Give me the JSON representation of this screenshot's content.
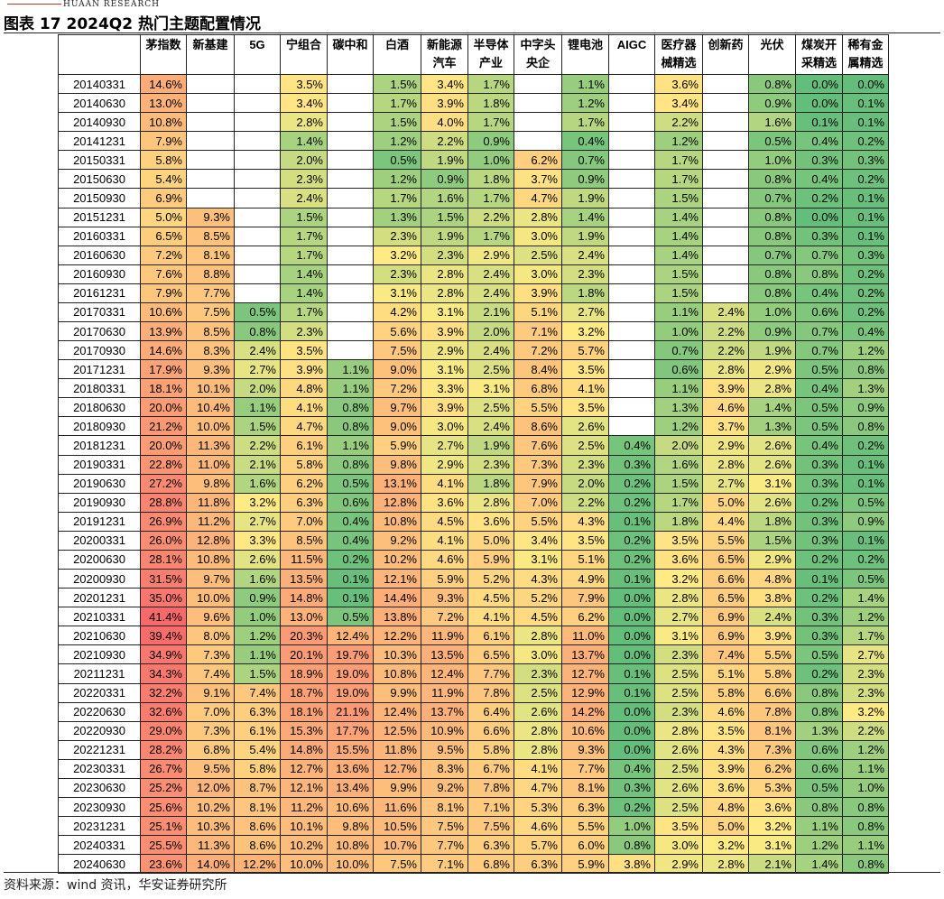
{
  "header": {
    "brand": "HUAAN RESEARCH",
    "title": "图表 17 2024Q2 热门主题配置情况"
  },
  "table": {
    "columns": [
      "",
      "茅指数",
      "新基建",
      "5G",
      "宁组合",
      "碳中和",
      "白酒",
      "新能源汽车",
      "半导体产业",
      "中字头央企",
      "锂电池",
      "AIGC",
      "医疗器械精选",
      "创新药",
      "光伏",
      "煤炭开采精选",
      "稀有金属精选"
    ],
    "rows": [
      [
        "20140331",
        "14.6%",
        "",
        "",
        "3.5%",
        "",
        "1.5%",
        "3.4%",
        "1.7%",
        "",
        "1.1%",
        "",
        "3.6%",
        "",
        "0.8%",
        "0.0%",
        "0.0%"
      ],
      [
        "20140630",
        "13.0%",
        "",
        "",
        "3.4%",
        "",
        "1.7%",
        "3.9%",
        "1.8%",
        "",
        "1.2%",
        "",
        "3.4%",
        "",
        "0.9%",
        "0.0%",
        "0.1%"
      ],
      [
        "20140930",
        "10.8%",
        "",
        "",
        "2.8%",
        "",
        "1.5%",
        "4.0%",
        "1.7%",
        "",
        "1.7%",
        "",
        "2.2%",
        "",
        "1.6%",
        "0.1%",
        "0.1%"
      ],
      [
        "20141231",
        "7.9%",
        "",
        "",
        "1.4%",
        "",
        "1.2%",
        "2.2%",
        "0.9%",
        "",
        "0.4%",
        "",
        "1.2%",
        "",
        "0.5%",
        "0.4%",
        "0.2%"
      ],
      [
        "20150331",
        "5.8%",
        "",
        "",
        "2.0%",
        "",
        "0.5%",
        "1.9%",
        "1.0%",
        "6.2%",
        "0.7%",
        "",
        "1.7%",
        "",
        "1.0%",
        "0.3%",
        "0.3%"
      ],
      [
        "20150630",
        "5.4%",
        "",
        "",
        "2.3%",
        "",
        "1.2%",
        "0.9%",
        "1.8%",
        "3.7%",
        "0.9%",
        "",
        "1.7%",
        "",
        "0.8%",
        "0.4%",
        "0.2%"
      ],
      [
        "20150930",
        "6.9%",
        "",
        "",
        "2.4%",
        "",
        "1.7%",
        "1.6%",
        "1.7%",
        "4.7%",
        "1.9%",
        "",
        "1.5%",
        "",
        "0.7%",
        "0.2%",
        "0.1%"
      ],
      [
        "20151231",
        "5.0%",
        "9.3%",
        "",
        "1.5%",
        "",
        "1.3%",
        "1.5%",
        "2.2%",
        "2.8%",
        "1.4%",
        "",
        "1.4%",
        "",
        "0.8%",
        "0.0%",
        "0.1%"
      ],
      [
        "20160331",
        "6.5%",
        "8.5%",
        "",
        "1.7%",
        "",
        "2.3%",
        "1.9%",
        "1.7%",
        "3.0%",
        "1.9%",
        "",
        "1.4%",
        "",
        "0.8%",
        "0.3%",
        "0.1%"
      ],
      [
        "20160630",
        "7.2%",
        "8.1%",
        "",
        "1.7%",
        "",
        "3.2%",
        "2.3%",
        "2.9%",
        "2.5%",
        "2.4%",
        "",
        "1.4%",
        "",
        "0.7%",
        "0.7%",
        "0.3%"
      ],
      [
        "20160930",
        "7.6%",
        "8.8%",
        "",
        "1.4%",
        "",
        "2.3%",
        "2.8%",
        "2.4%",
        "3.0%",
        "2.3%",
        "",
        "1.5%",
        "",
        "0.8%",
        "0.8%",
        "0.2%"
      ],
      [
        "20161231",
        "7.9%",
        "7.7%",
        "",
        "1.4%",
        "",
        "3.1%",
        "2.8%",
        "2.4%",
        "3.9%",
        "1.8%",
        "",
        "1.5%",
        "",
        "0.8%",
        "0.4%",
        "0.2%"
      ],
      [
        "20170331",
        "10.6%",
        "7.5%",
        "0.5%",
        "1.7%",
        "",
        "4.2%",
        "3.1%",
        "2.1%",
        "5.1%",
        "2.7%",
        "",
        "1.1%",
        "2.4%",
        "1.0%",
        "0.6%",
        "0.2%"
      ],
      [
        "20170630",
        "13.9%",
        "8.5%",
        "0.8%",
        "2.3%",
        "",
        "5.6%",
        "3.9%",
        "2.0%",
        "7.1%",
        "3.2%",
        "",
        "1.0%",
        "2.2%",
        "0.9%",
        "0.7%",
        "0.4%"
      ],
      [
        "20170930",
        "14.6%",
        "8.3%",
        "2.4%",
        "3.5%",
        "",
        "7.5%",
        "2.9%",
        "2.4%",
        "7.2%",
        "5.7%",
        "",
        "0.7%",
        "2.2%",
        "1.9%",
        "0.7%",
        "1.2%"
      ],
      [
        "20171231",
        "17.9%",
        "9.3%",
        "2.7%",
        "3.9%",
        "1.1%",
        "9.0%",
        "3.1%",
        "2.5%",
        "8.4%",
        "3.5%",
        "",
        "0.6%",
        "2.8%",
        "2.9%",
        "0.5%",
        "0.8%"
      ],
      [
        "20180331",
        "18.1%",
        "10.1%",
        "2.0%",
        "4.8%",
        "1.1%",
        "7.2%",
        "3.3%",
        "3.1%",
        "6.8%",
        "4.1%",
        "",
        "1.1%",
        "3.9%",
        "2.8%",
        "0.4%",
        "1.3%"
      ],
      [
        "20180630",
        "20.0%",
        "10.4%",
        "1.1%",
        "4.1%",
        "0.8%",
        "9.7%",
        "3.9%",
        "2.5%",
        "5.5%",
        "3.5%",
        "",
        "1.3%",
        "4.6%",
        "1.4%",
        "0.5%",
        "0.9%"
      ],
      [
        "20180930",
        "21.2%",
        "10.0%",
        "1.5%",
        "4.7%",
        "0.8%",
        "9.0%",
        "3.0%",
        "2.4%",
        "8.6%",
        "2.6%",
        "",
        "1.2%",
        "3.7%",
        "1.3%",
        "0.5%",
        "0.8%"
      ],
      [
        "20181231",
        "20.0%",
        "11.3%",
        "2.2%",
        "6.1%",
        "1.1%",
        "5.9%",
        "2.7%",
        "1.9%",
        "7.6%",
        "2.5%",
        "0.4%",
        "2.0%",
        "2.9%",
        "2.6%",
        "0.4%",
        "0.2%"
      ],
      [
        "20190331",
        "22.8%",
        "11.0%",
        "2.1%",
        "5.8%",
        "0.8%",
        "9.8%",
        "2.9%",
        "2.3%",
        "7.3%",
        "2.3%",
        "0.3%",
        "1.6%",
        "2.8%",
        "2.6%",
        "0.3%",
        "0.1%"
      ],
      [
        "20190630",
        "27.2%",
        "9.8%",
        "1.6%",
        "6.2%",
        "0.5%",
        "13.1%",
        "4.1%",
        "1.8%",
        "7.9%",
        "2.0%",
        "0.2%",
        "1.5%",
        "2.7%",
        "3.1%",
        "0.3%",
        "0.1%"
      ],
      [
        "20190930",
        "28.8%",
        "11.8%",
        "3.2%",
        "6.3%",
        "0.6%",
        "12.8%",
        "3.6%",
        "2.8%",
        "7.0%",
        "2.2%",
        "0.2%",
        "1.7%",
        "5.0%",
        "2.6%",
        "0.2%",
        "0.5%"
      ],
      [
        "20191231",
        "26.9%",
        "11.2%",
        "2.7%",
        "7.0%",
        "0.4%",
        "10.8%",
        "4.5%",
        "3.6%",
        "5.5%",
        "4.3%",
        "0.1%",
        "1.8%",
        "4.4%",
        "1.8%",
        "0.3%",
        "0.9%"
      ],
      [
        "20200331",
        "26.0%",
        "12.8%",
        "3.3%",
        "8.5%",
        "0.4%",
        "9.2%",
        "4.1%",
        "5.0%",
        "3.4%",
        "3.5%",
        "0.2%",
        "3.5%",
        "5.5%",
        "1.5%",
        "0.3%",
        "0.1%"
      ],
      [
        "20200630",
        "28.1%",
        "10.8%",
        "2.6%",
        "11.5%",
        "0.2%",
        "10.2%",
        "4.6%",
        "5.9%",
        "3.1%",
        "5.1%",
        "0.2%",
        "3.6%",
        "6.5%",
        "2.9%",
        "0.2%",
        "0.2%"
      ],
      [
        "20200930",
        "31.5%",
        "9.7%",
        "1.6%",
        "13.5%",
        "0.1%",
        "12.1%",
        "5.9%",
        "5.2%",
        "4.3%",
        "4.9%",
        "0.1%",
        "3.2%",
        "6.6%",
        "4.8%",
        "0.1%",
        "0.5%"
      ],
      [
        "20201231",
        "35.0%",
        "10.0%",
        "0.9%",
        "14.8%",
        "0.1%",
        "14.4%",
        "9.3%",
        "4.5%",
        "5.2%",
        "7.9%",
        "0.0%",
        "2.8%",
        "6.5%",
        "3.8%",
        "0.2%",
        "1.4%"
      ],
      [
        "20210331",
        "41.4%",
        "9.6%",
        "1.0%",
        "13.0%",
        "0.5%",
        "13.8%",
        "7.2%",
        "4.1%",
        "4.5%",
        "6.2%",
        "0.0%",
        "2.7%",
        "6.9%",
        "2.4%",
        "0.3%",
        "1.2%"
      ],
      [
        "20210630",
        "39.4%",
        "8.0%",
        "1.2%",
        "20.3%",
        "12.4%",
        "12.2%",
        "11.9%",
        "6.1%",
        "2.8%",
        "11.0%",
        "0.0%",
        "3.1%",
        "6.9%",
        "3.9%",
        "0.3%",
        "1.7%"
      ],
      [
        "20210930",
        "34.9%",
        "7.3%",
        "1.1%",
        "20.1%",
        "19.7%",
        "10.3%",
        "13.5%",
        "6.5%",
        "3.0%",
        "13.7%",
        "0.0%",
        "2.3%",
        "7.4%",
        "5.5%",
        "0.5%",
        "2.7%"
      ],
      [
        "20211231",
        "34.3%",
        "7.4%",
        "1.5%",
        "18.9%",
        "19.0%",
        "10.8%",
        "12.4%",
        "7.7%",
        "2.3%",
        "12.7%",
        "0.1%",
        "2.5%",
        "5.1%",
        "5.8%",
        "0.2%",
        "2.3%"
      ],
      [
        "20220331",
        "32.2%",
        "9.1%",
        "7.4%",
        "18.7%",
        "19.0%",
        "9.9%",
        "11.9%",
        "7.8%",
        "2.5%",
        "12.9%",
        "0.1%",
        "2.5%",
        "5.8%",
        "6.6%",
        "0.8%",
        "2.3%"
      ],
      [
        "20220630",
        "32.6%",
        "7.0%",
        "6.3%",
        "18.1%",
        "21.1%",
        "12.4%",
        "13.7%",
        "6.4%",
        "2.6%",
        "14.2%",
        "0.0%",
        "2.3%",
        "4.6%",
        "7.8%",
        "0.8%",
        "3.2%"
      ],
      [
        "20220930",
        "29.0%",
        "7.3%",
        "6.1%",
        "15.3%",
        "17.7%",
        "12.5%",
        "10.9%",
        "6.6%",
        "2.8%",
        "10.6%",
        "0.0%",
        "2.8%",
        "3.5%",
        "8.1%",
        "1.3%",
        "2.2%"
      ],
      [
        "20221231",
        "28.2%",
        "6.8%",
        "5.4%",
        "14.8%",
        "15.5%",
        "11.8%",
        "9.5%",
        "5.8%",
        "2.8%",
        "9.3%",
        "0.0%",
        "2.6%",
        "4.3%",
        "7.3%",
        "0.6%",
        "1.2%"
      ],
      [
        "20230331",
        "26.7%",
        "9.5%",
        "5.8%",
        "12.7%",
        "13.6%",
        "12.7%",
        "8.3%",
        "6.7%",
        "4.1%",
        "7.7%",
        "0.4%",
        "2.5%",
        "3.9%",
        "6.2%",
        "0.6%",
        "1.1%"
      ],
      [
        "20230630",
        "25.2%",
        "12.0%",
        "8.7%",
        "12.1%",
        "13.4%",
        "9.9%",
        "9.2%",
        "7.8%",
        "4.7%",
        "8.1%",
        "0.3%",
        "2.6%",
        "3.6%",
        "5.3%",
        "0.5%",
        "1.0%"
      ],
      [
        "20230930",
        "25.6%",
        "10.2%",
        "8.1%",
        "11.2%",
        "10.6%",
        "11.6%",
        "8.1%",
        "7.1%",
        "5.3%",
        "6.3%",
        "0.2%",
        "2.5%",
        "4.8%",
        "3.6%",
        "0.8%",
        "0.8%"
      ],
      [
        "20231231",
        "25.1%",
        "10.3%",
        "8.6%",
        "10.1%",
        "9.8%",
        "10.5%",
        "7.5%",
        "7.5%",
        "4.6%",
        "5.5%",
        "1.0%",
        "3.5%",
        "5.0%",
        "3.2%",
        "1.1%",
        "0.8%"
      ],
      [
        "20240331",
        "25.5%",
        "11.3%",
        "8.6%",
        "10.2%",
        "10.8%",
        "10.7%",
        "7.7%",
        "6.3%",
        "5.7%",
        "6.0%",
        "0.8%",
        "3.0%",
        "3.2%",
        "3.1%",
        "1.2%",
        "1.1%"
      ],
      [
        "20240630",
        "23.6%",
        "14.0%",
        "12.2%",
        "10.0%",
        "10.0%",
        "7.5%",
        "7.1%",
        "6.8%",
        "6.3%",
        "5.9%",
        "3.8%",
        "2.9%",
        "2.8%",
        "2.1%",
        "1.4%",
        "0.8%"
      ]
    ]
  },
  "footer": {
    "source": "资料来源：wind 资讯，华安证券研究所"
  },
  "colors": {
    "scale_low": "#63be7b",
    "scale_mid": "#ffeb84",
    "scale_high": "#f8696b"
  }
}
